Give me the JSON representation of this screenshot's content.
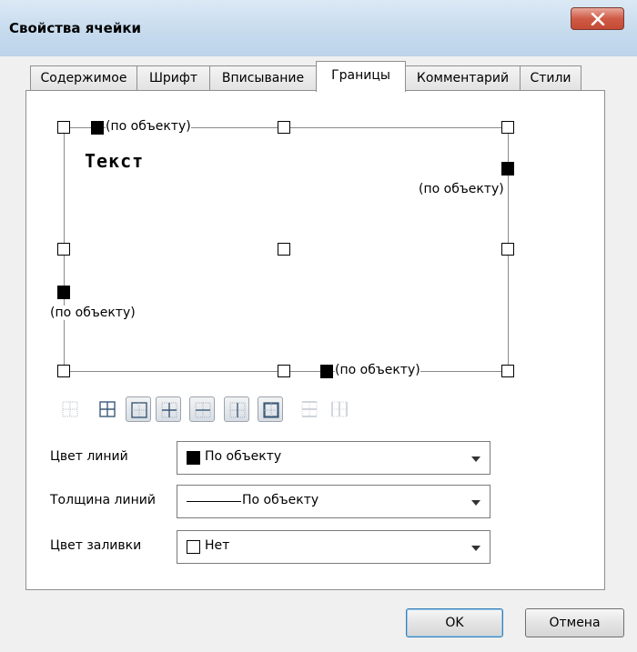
{
  "window": {
    "title": "Свойства ячейки",
    "close_glyph": "X"
  },
  "tabs": [
    {
      "label": "Содержимое",
      "active": false
    },
    {
      "label": "Шрифт",
      "active": false
    },
    {
      "label": "Вписывание",
      "active": false
    },
    {
      "label": "Границы",
      "active": true
    },
    {
      "label": "Комментарий",
      "active": false
    },
    {
      "label": "Стили",
      "active": false
    }
  ],
  "borders": {
    "sample_text": "Текст",
    "top_label": "(по объекту)",
    "right_label": "(по объекту)",
    "left_label": "(по объекту)",
    "bottom_label": "(по объекту)"
  },
  "presets": [
    {
      "icon": "no-borders-icon",
      "selected": false
    },
    {
      "icon": "all-borders-icon",
      "selected": false
    },
    {
      "icon": "outer-borders-icon",
      "selected": true
    },
    {
      "icon": "inner-borders-icon",
      "selected": true
    },
    {
      "icon": "inner-horizontal-icon",
      "selected": true
    },
    {
      "icon": "inner-vertical-icon",
      "selected": true
    },
    {
      "icon": "outer-thick-icon",
      "selected": true
    },
    {
      "icon": "horizontal-borders-icon",
      "selected": false
    },
    {
      "icon": "vertical-borders-icon",
      "selected": false
    }
  ],
  "properties": {
    "line_color": {
      "label": "Цвет линий",
      "value": "По объекту"
    },
    "line_width": {
      "label": "Толщина линий",
      "value": "По объекту"
    },
    "fill_color": {
      "label": "Цвет заливки",
      "value": "Нет"
    }
  },
  "buttons": {
    "ok": "OK",
    "cancel": "Отмена"
  },
  "colors": {
    "titlebar": "#c7dbee",
    "close_button": "#cf5a45",
    "default_button_border": "#3c7fb1"
  }
}
